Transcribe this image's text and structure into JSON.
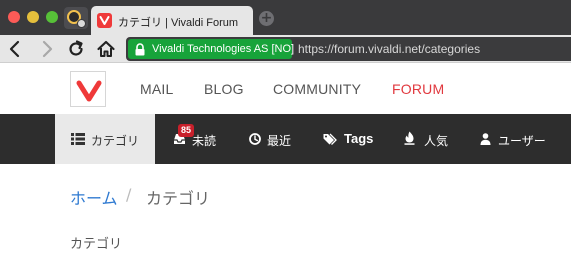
{
  "window": {
    "tab_title": "カテゴリ | Vivaldi Forum",
    "favicon": "vivaldi-logo-icon",
    "new_tab_icon": "plus-icon"
  },
  "address_bar": {
    "certificate_label": "Vivaldi Technologies AS [NO]",
    "url": "https://forum.vivaldi.net/categories",
    "secure_color": "#17a33a"
  },
  "site_nav": {
    "items": [
      {
        "label": "MAIL",
        "active": false
      },
      {
        "label": "BLOG",
        "active": false
      },
      {
        "label": "COMMUNITY",
        "active": false
      },
      {
        "label": "FORUM",
        "active": true
      }
    ],
    "active_color": "#e1393f"
  },
  "forum_nav": {
    "items": [
      {
        "label": "カテゴリ",
        "icon": "list-icon",
        "active": true
      },
      {
        "label": "未読",
        "icon": "inbox-icon",
        "badge": "85"
      },
      {
        "label": "最近",
        "icon": "clock-icon"
      },
      {
        "label": "Tags",
        "icon": "tags-icon"
      },
      {
        "label": "人気",
        "icon": "fire-icon"
      },
      {
        "label": "ユーザー",
        "icon": "user-icon"
      }
    ]
  },
  "breadcrumb": {
    "home": "ホーム",
    "separator": "/",
    "current": "カテゴリ"
  },
  "main": {
    "section_label": "カテゴリ"
  }
}
